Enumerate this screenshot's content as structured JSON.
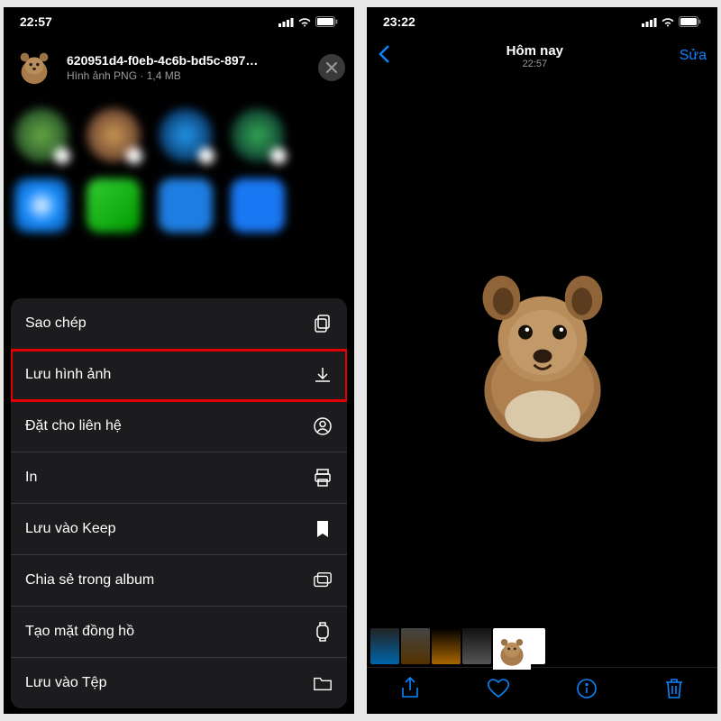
{
  "left": {
    "status_time": "22:57",
    "file": {
      "name": "620951d4-f0eb-4c6b-bd5c-897…",
      "meta": "Hình ảnh PNG · 1,4 MB"
    },
    "actions": [
      {
        "label": "Sao chép",
        "icon": "copy-icon",
        "highlight": false
      },
      {
        "label": "Lưu hình ảnh",
        "icon": "download-icon",
        "highlight": true
      },
      {
        "label": "Đặt cho liên hệ",
        "icon": "contact-icon",
        "highlight": false
      },
      {
        "label": "In",
        "icon": "print-icon",
        "highlight": false
      },
      {
        "label": "Lưu vào Keep",
        "icon": "bookmark-icon",
        "highlight": false
      },
      {
        "label": "Chia sẻ trong album",
        "icon": "album-icon",
        "highlight": false
      },
      {
        "label": "Tạo mặt đồng hồ",
        "icon": "watch-icon",
        "highlight": false
      },
      {
        "label": "Lưu vào Tệp",
        "icon": "folder-icon",
        "highlight": false
      }
    ]
  },
  "right": {
    "status_time": "23:22",
    "nav_title": "Hôm nay",
    "nav_subtitle": "22:57",
    "edit_label": "Sửa"
  }
}
